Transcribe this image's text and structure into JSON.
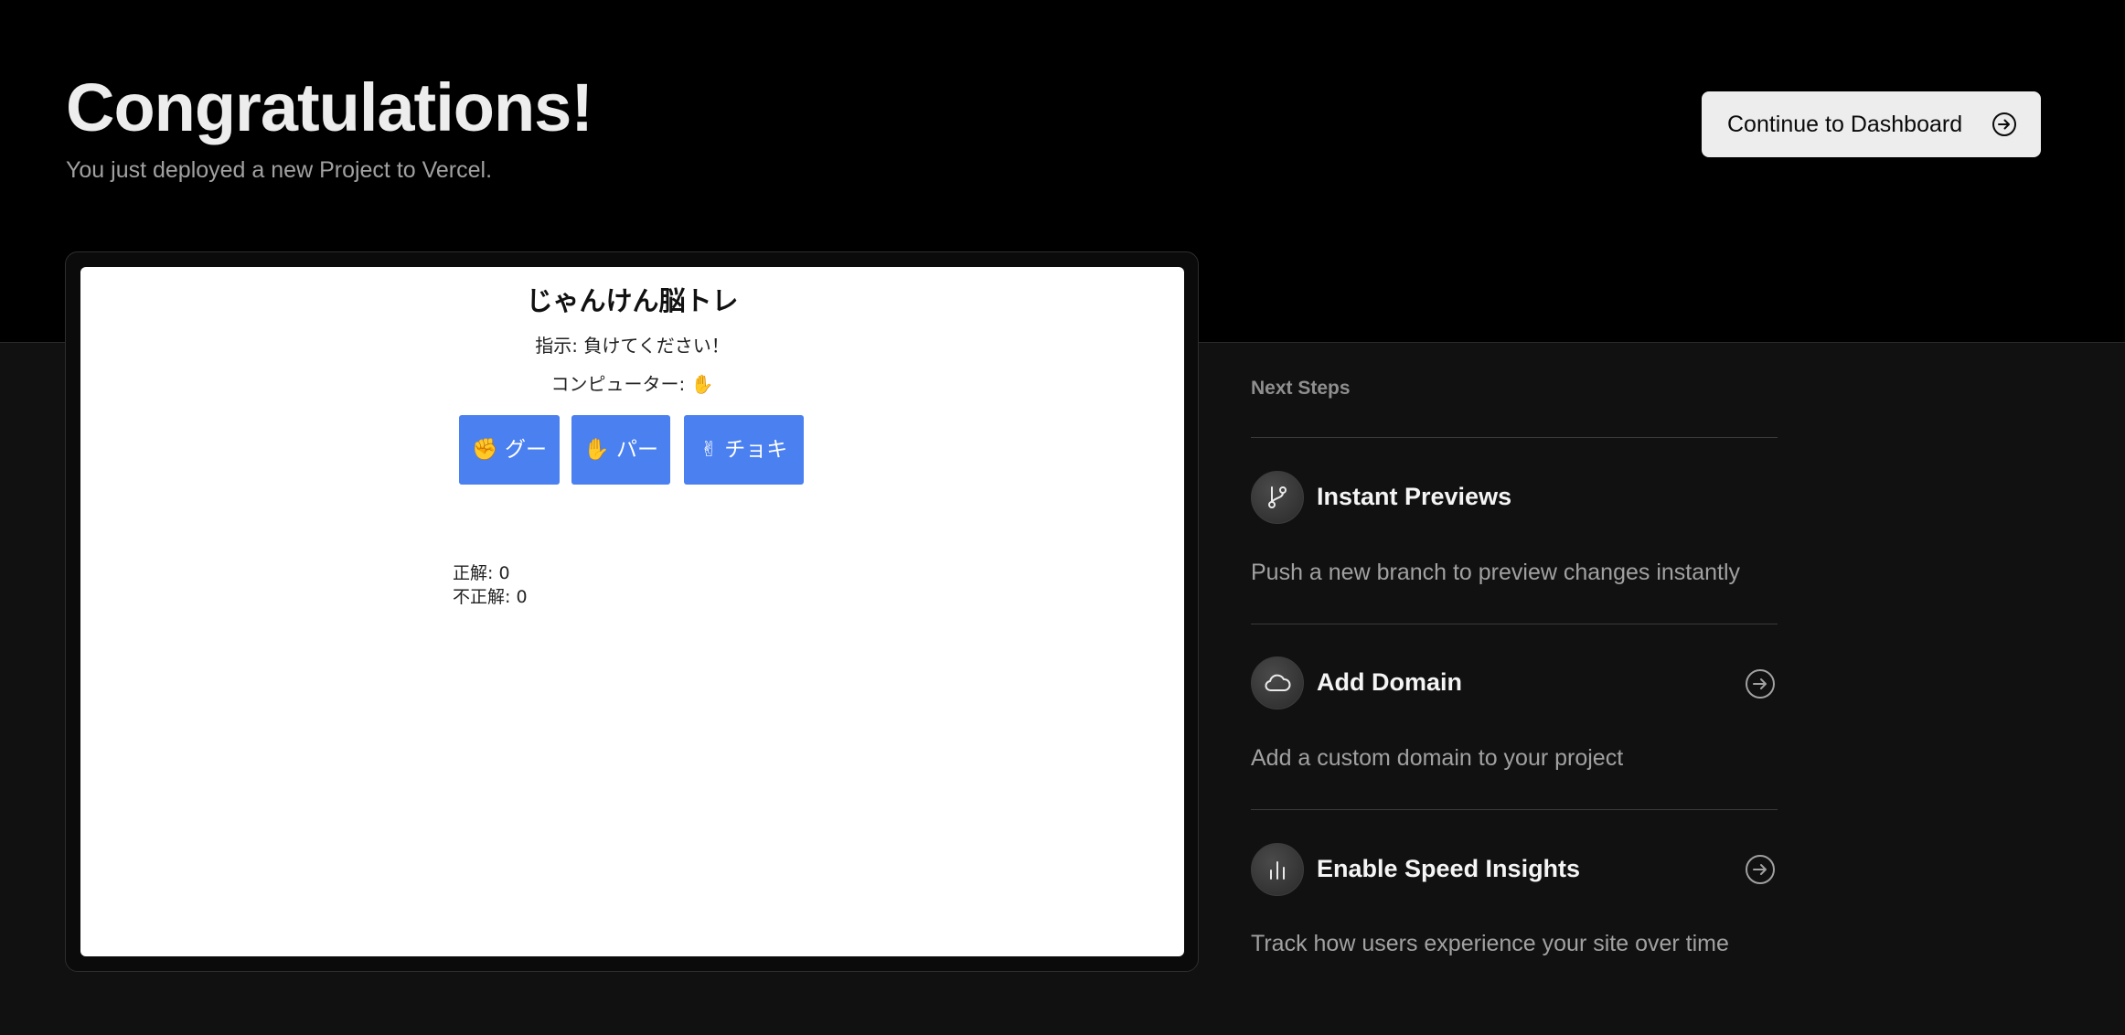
{
  "header": {
    "title": "Congratulations!",
    "subtitle": "You just deployed a new Project to Vercel.",
    "dashboard_button": "Continue to Dashboard"
  },
  "preview": {
    "game_title": "じゃんけん脳トレ",
    "instruction": "指示: 負けてください！",
    "computer": "コンピューター: ✋",
    "buttons": [
      "✊ グー",
      "✋ パー",
      "✌ チョキ"
    ],
    "correct": "正解: 0",
    "incorrect": "不正解: 0"
  },
  "next_steps": {
    "heading": "Next Steps",
    "items": [
      {
        "title": "Instant Previews",
        "description": "Push a new branch to preview changes instantly",
        "icon": "git-branch-icon"
      },
      {
        "title": "Add Domain",
        "description": "Add a custom domain to your project",
        "icon": "cloud-icon"
      },
      {
        "title": "Enable Speed Insights",
        "description": "Track how users experience your site over time",
        "icon": "bar-chart-icon"
      }
    ]
  },
  "colors": {
    "top_background": "#000000",
    "page_background": "#111111",
    "game_button": "#4a80f0"
  }
}
